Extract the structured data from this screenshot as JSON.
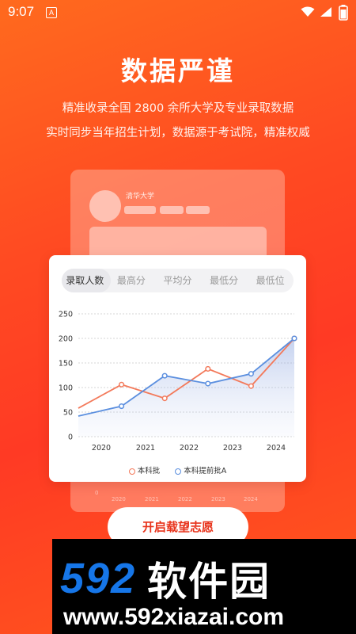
{
  "status_bar": {
    "time": "9:07",
    "a_badge": "A"
  },
  "hero": {
    "title": "数据严谨",
    "subtitle_1": "精准收录全国 2800 余所大学及专业录取数据",
    "subtitle_2": "实时同步当年招生计划，数据源于考试院，精准权威"
  },
  "background_card": {
    "user_name": "清华大学",
    "x_labels": [
      "2020",
      "2021",
      "2022",
      "2023",
      "2024"
    ],
    "zero": "0"
  },
  "tabs": [
    {
      "label": "录取人数",
      "active": true
    },
    {
      "label": "最高分",
      "active": false
    },
    {
      "label": "平均分",
      "active": false
    },
    {
      "label": "最低分",
      "active": false
    },
    {
      "label": "最低位",
      "active": false
    }
  ],
  "chart_data": {
    "type": "line",
    "categories": [
      "2020",
      "2021",
      "2022",
      "2023",
      "2024"
    ],
    "x": [
      2019.5,
      2020.5,
      2021,
      2021.5,
      2022.5,
      2023,
      2023.5,
      2024.5
    ],
    "series": [
      {
        "name": "本科批",
        "color": "#f37a5b",
        "values": [
          58,
          106,
          78,
          138,
          103,
          200
        ]
      },
      {
        "name": "本科提前批A",
        "color": "#5b8fdf",
        "values": [
          42,
          62,
          124,
          108,
          128,
          200
        ]
      }
    ],
    "yticks": [
      0,
      50,
      100,
      150,
      200,
      250
    ],
    "ylim": [
      0,
      250
    ],
    "grid": true,
    "legend_position": "bottom"
  },
  "cta_label": "开启载望志愿",
  "watermark": {
    "number": "592",
    "name": "软件园",
    "url": "www.592xiazai.com"
  }
}
